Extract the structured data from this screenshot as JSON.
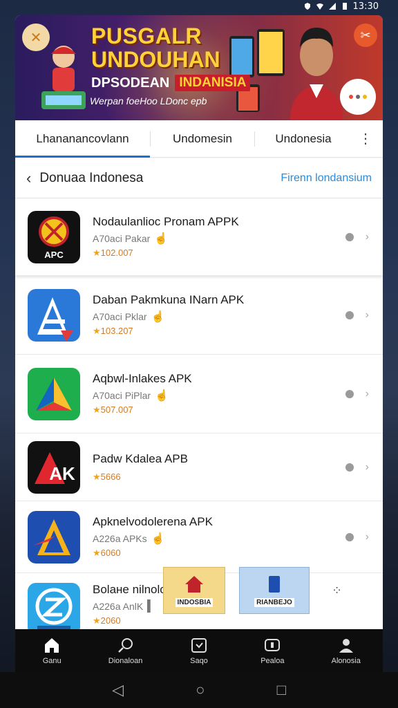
{
  "status_bar": {
    "time": "13:30"
  },
  "banner": {
    "title_line1": "PUSGALR",
    "title_line2": "UNDOUHAN",
    "sub_word": "DPSODEAN",
    "sub_red": "INDANISIA",
    "tagline": "Werpan foeHoo LDonc epb"
  },
  "tabs": {
    "items": [
      "Lhananancovlann",
      "Undomesin",
      "Undonesia"
    ]
  },
  "section": {
    "title": "Donuaa Indonesa",
    "link": "Firenn londansium"
  },
  "apps": [
    {
      "name": "Nodaulanlioc Pronam APPK",
      "sub": "A70aci Pakar",
      "rating": "102.007",
      "icon": "apc-icon",
      "icon_label": "APC"
    },
    {
      "name": "Daban Pakmkuna INarn APK",
      "sub": "A70aci Pklar",
      "rating": "103.207",
      "icon": "a-logo-icon"
    },
    {
      "name": "Aqbwl-Inlakes APK",
      "sub": "A70aci PiPlar",
      "rating": "507.007",
      "icon": "arrow-logo-icon"
    },
    {
      "name": "Padw Kdalea APB",
      "sub": "",
      "rating": "5666",
      "icon": "ak-logo-icon",
      "icon_label": "AK"
    },
    {
      "name": "Apknelvodolerena APK",
      "sub": "A226a APKs",
      "rating": "6060",
      "icon": "triangle-logo-icon"
    },
    {
      "name": "Bolaне nilnoloas APK",
      "sub": "A226a AnlK",
      "rating": "2060",
      "icon": "z-logo-icon"
    }
  ],
  "ads": {
    "ad1_label": "INDOSBIA",
    "ad2_label": "RIANBEJO"
  },
  "bottom_nav": {
    "items": [
      {
        "label": "Ganu",
        "icon": "home-icon"
      },
      {
        "label": "Dionaloan",
        "icon": "search-icon"
      },
      {
        "label": "Saqo",
        "icon": "calendar-icon"
      },
      {
        "label": "Pealoa",
        "icon": "ticket-icon"
      },
      {
        "label": "Alonosia",
        "icon": "profile-icon"
      }
    ]
  }
}
